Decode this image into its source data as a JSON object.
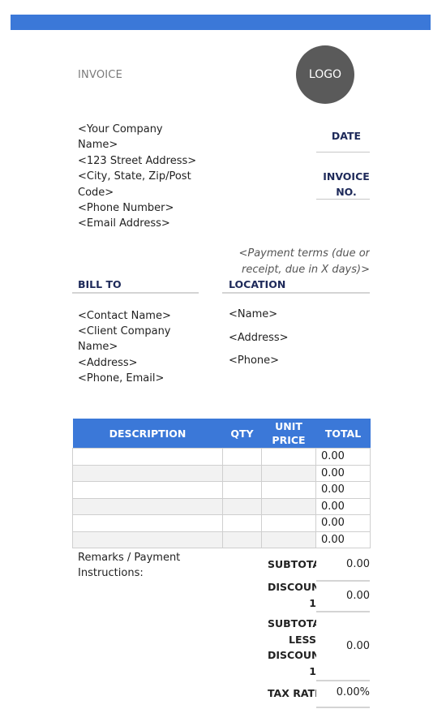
{
  "header": {
    "title": "INVOICE",
    "logo_label": "LOGO",
    "accent_color": "#3b78d8"
  },
  "company": {
    "lines": [
      "<Your Company",
      "Name>",
      "<123 Street Address>",
      "<City, State, Zip/Post",
      "Code>",
      "<Phone Number>",
      "<Email Address>"
    ]
  },
  "meta": {
    "date_label": "DATE",
    "invoice_no_label_1": "INVOICE",
    "invoice_no_label_2": "NO.",
    "payment_terms_1": "<Payment terms (due or",
    "payment_terms_2": "receipt, due in X days)>"
  },
  "bill_to": {
    "label": "BILL TO",
    "lines": [
      "<Contact Name>",
      "<Client Company",
      "Name>",
      "<Address>",
      "<Phone, Email>"
    ]
  },
  "location": {
    "label": "LOCATION",
    "lines": [
      "<Name>",
      "<Address>",
      "<Phone>"
    ]
  },
  "items_table": {
    "headers": {
      "description": "DESCRIPTION",
      "qty": "QTY",
      "unit_price_1": "UNIT",
      "unit_price_2": "PRICE",
      "total": "TOTAL"
    },
    "rows": [
      {
        "description": "",
        "qty": "",
        "unit_price": "",
        "total": "0.00"
      },
      {
        "description": "",
        "qty": "",
        "unit_price": "",
        "total": "0.00"
      },
      {
        "description": "",
        "qty": "",
        "unit_price": "",
        "total": "0.00"
      },
      {
        "description": "",
        "qty": "",
        "unit_price": "",
        "total": "0.00"
      },
      {
        "description": "",
        "qty": "",
        "unit_price": "",
        "total": "0.00"
      },
      {
        "description": "",
        "qty": "",
        "unit_price": "",
        "total": "0.00"
      }
    ]
  },
  "remarks": {
    "line1": "Remarks / Payment",
    "line2": "Instructions:"
  },
  "summary": {
    "subtotal_label": "SUBTOTAL",
    "subtotal_value": "0.00",
    "discount_label_1": "DISCOUNT",
    "discount_label_2": "1",
    "discount_value": "0.00",
    "subtotal_less_label_1": "SUBTOTAL",
    "subtotal_less_label_2": "LESS",
    "subtotal_less_label_3": "DISCOUNT",
    "subtotal_less_label_4": "1",
    "subtotal_less_value": "0.00",
    "tax_rate_label": "TAX RATE",
    "tax_rate_value": "0.00%"
  }
}
